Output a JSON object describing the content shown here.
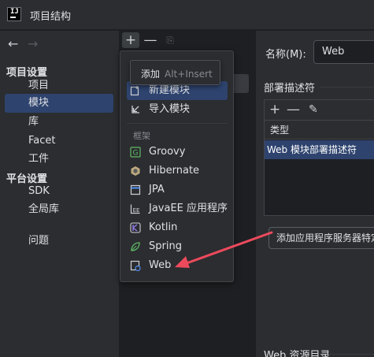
{
  "window": {
    "title": "项目结构"
  },
  "nav": {
    "back_glyph": "←",
    "forward_glyph": "→"
  },
  "sidebar": {
    "project_settings_header": "项目设置",
    "project_items": [
      "项目",
      "模块",
      "库",
      "Facet",
      "工件"
    ],
    "platform_settings_header": "平台设置",
    "platform_items": [
      "SDK",
      "全局库"
    ],
    "problems_item": "问题",
    "selected": "模块"
  },
  "module_toolbar": {
    "add_glyph": "+",
    "remove_glyph": "—",
    "copy_glyph": "⎘"
  },
  "add_menu": {
    "tooltip_label": "添加",
    "tooltip_shortcut": "Alt+Insert",
    "new_module": "新建模块",
    "import_module": "导入模块",
    "frameworks_header": "框架",
    "frameworks": [
      "Groovy",
      "Hibernate",
      "JPA",
      "JavaEE 应用程序",
      "Kotlin",
      "Spring",
      "Web"
    ],
    "highlighted": "新建模块"
  },
  "facet": {
    "name_label": "名称(M):",
    "name_value": "Web",
    "descriptors_header": "部署描述符",
    "table_add_glyph": "+",
    "table_remove_glyph": "—",
    "table_edit_glyph": "✎",
    "type_column": "类型",
    "descriptor_row": "Web 模块部署描述符",
    "add_server_button": "添加应用程序服务器特定",
    "web_resources_header": "Web 资源目录"
  },
  "colors": {
    "background": "#1e1f22",
    "panel": "#2b2d30",
    "selection": "#2e436e",
    "annotation_arrow": "#ec4a5c"
  }
}
